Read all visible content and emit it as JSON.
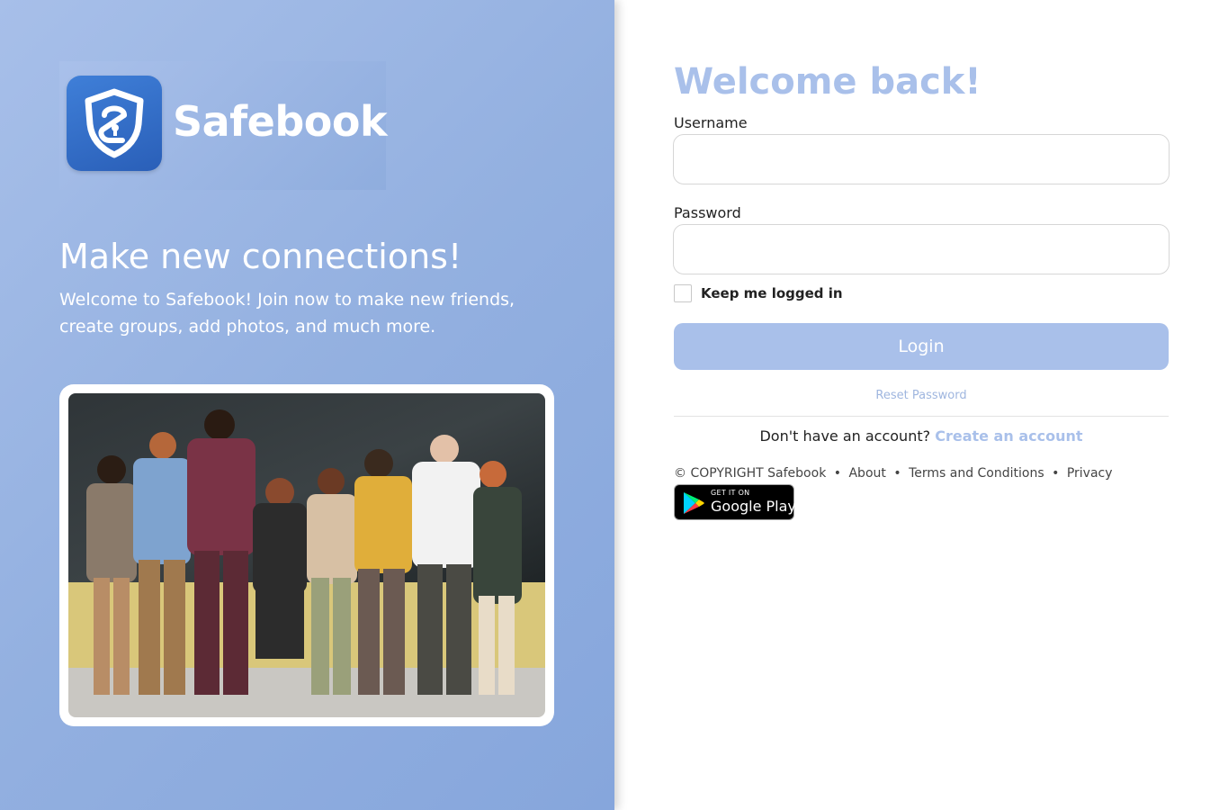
{
  "brand": {
    "name": "Safebook",
    "primary_color": "#a9c0ea",
    "icon": "shield-lock-icon"
  },
  "left": {
    "tagline": "Make new connections!",
    "intro": "Welcome to Safebook! Join now to make new friends, create groups, add photos, and much more."
  },
  "login": {
    "heading": "Welcome back!",
    "username_label": "Username",
    "username_value": "",
    "password_label": "Password",
    "password_value": "",
    "remember_label": "Keep me logged in",
    "remember_checked": false,
    "button_label": "Login",
    "reset_label": "Reset Password",
    "signup_prompt": "Don't have an account?",
    "signup_link": "Create an account"
  },
  "footer": {
    "copyright": "© COPYRIGHT Safebook",
    "separator": "•",
    "links": [
      "About",
      "Terms and Conditions",
      "Privacy"
    ]
  },
  "store_badge": {
    "line1": "GET IT ON",
    "line2": "Google Play"
  }
}
